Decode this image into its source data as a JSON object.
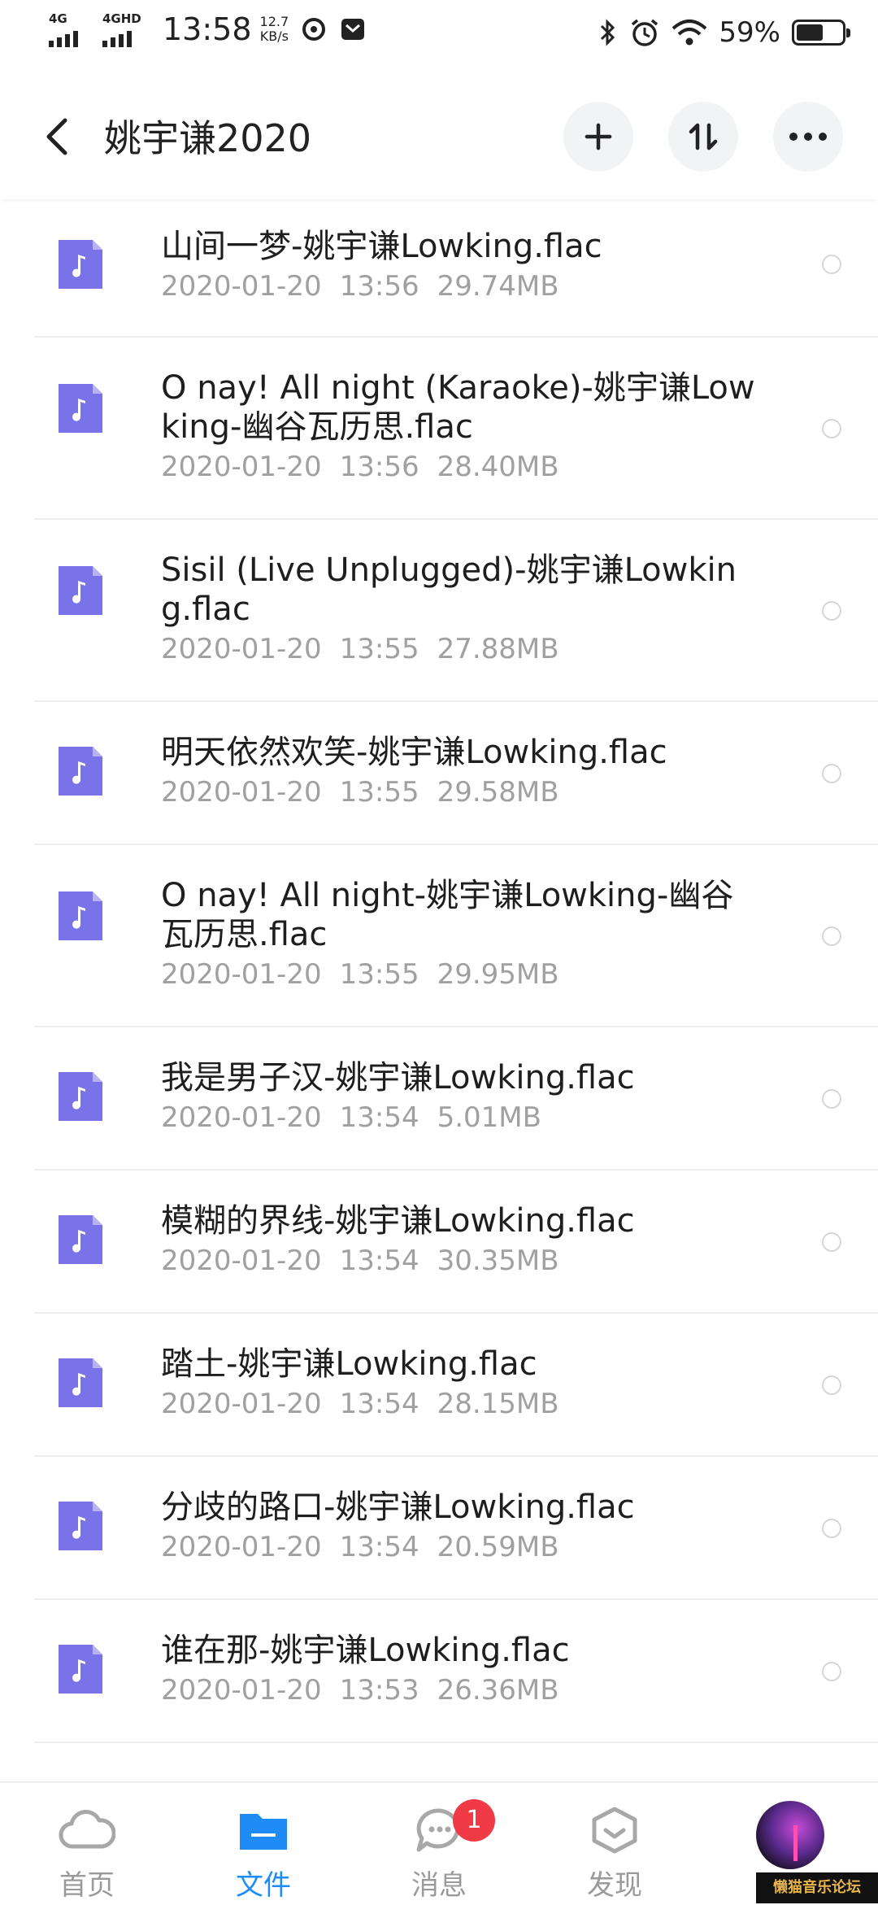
{
  "status_bar": {
    "network1": "4G",
    "network2": "4GHD",
    "time": "13:58",
    "speed_value": "12.7",
    "speed_unit": "KB/s",
    "battery_percent": "59%",
    "battery_level": 0.59
  },
  "header": {
    "title": "姚宇谦2020",
    "icons": [
      "back-arrow-icon",
      "plus-icon",
      "sort-icon",
      "more-icon"
    ]
  },
  "files": [
    {
      "name": "山间一梦-姚宇谦Lowking.flac",
      "date": "2020-01-20",
      "time": "13:56",
      "size": "29.74MB"
    },
    {
      "name": "O nay! All night (Karaoke)-姚宇谦Lowking-幽谷瓦历思.flac",
      "date": "2020-01-20",
      "time": "13:56",
      "size": "28.40MB"
    },
    {
      "name": "Sisil (Live Unplugged)-姚宇谦Lowking.flac",
      "date": "2020-01-20",
      "time": "13:55",
      "size": "27.88MB"
    },
    {
      "name": "明天依然欢笑-姚宇谦Lowking.flac",
      "date": "2020-01-20",
      "time": "13:55",
      "size": "29.58MB"
    },
    {
      "name": "O nay! All night-姚宇谦Lowking-幽谷瓦历思.flac",
      "date": "2020-01-20",
      "time": "13:55",
      "size": "29.95MB"
    },
    {
      "name": "我是男子汉-姚宇谦Lowking.flac",
      "date": "2020-01-20",
      "time": "13:54",
      "size": "5.01MB"
    },
    {
      "name": "模糊的界线-姚宇谦Lowking.flac",
      "date": "2020-01-20",
      "time": "13:54",
      "size": "30.35MB"
    },
    {
      "name": "踏土-姚宇谦Lowking.flac",
      "date": "2020-01-20",
      "time": "13:54",
      "size": "28.15MB"
    },
    {
      "name": "分歧的路口-姚宇谦Lowking.flac",
      "date": "2020-01-20",
      "time": "13:54",
      "size": "20.59MB"
    },
    {
      "name": "谁在那-姚宇谦Lowking.flac",
      "date": "2020-01-20",
      "time": "13:53",
      "size": "26.36MB"
    }
  ],
  "bottom_nav": {
    "home": "首页",
    "files": "文件",
    "messages": "消息",
    "messages_badge": "1",
    "discover": "发现",
    "active": "files"
  },
  "watermark": "懒猫音乐论坛",
  "colors": {
    "accent": "#1f8cf5",
    "file_icon": "#7a72e8",
    "badge": "#f03a45",
    "meta_text": "#a0a0a0"
  }
}
